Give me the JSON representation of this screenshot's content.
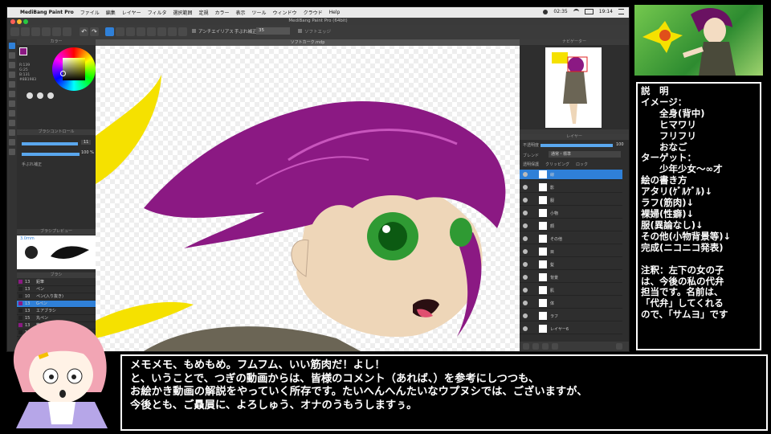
{
  "app": {
    "menubar": {
      "apple": "",
      "items": [
        "MediBang Paint Pro",
        "ファイル",
        "編集",
        "レイヤー",
        "フィルタ",
        "選択範囲",
        "定規",
        "カラー",
        "表示",
        "ツール",
        "ウィンドウ",
        "クラウド",
        "Help"
      ],
      "time1": "02:35",
      "time2": "19:14"
    },
    "window_title": "MediBang Paint Pro (64bit)",
    "toolbar": {
      "antialias": "アンチエイリアス",
      "correction_label": "手ぶれ補正",
      "correction_value": "35",
      "edit_label": "ソフトエッジ"
    },
    "document_tab": "ソフトカーク.mdp",
    "left_panels": {
      "color": "カラー",
      "color_values": [
        "R:139",
        "G:25",
        "B:131",
        "#8B1983"
      ],
      "brush_control": "ブラシコントロール",
      "brush_size_value": "11",
      "opacity_value": "100 %",
      "brush_option": "手ぶれ補正",
      "brush_preview": "ブラシプレビュー",
      "brush_preview_size": "3.0mm",
      "brush": "ブラシ",
      "brush_list": [
        {
          "num": "13",
          "name": "鉛筆"
        },
        {
          "num": "13",
          "name": "ペン"
        },
        {
          "num": "10",
          "name": "ペン(入り抜き)"
        },
        {
          "num": "13",
          "name": "Gペン"
        },
        {
          "num": "13",
          "name": "エアブラシ"
        },
        {
          "num": "15",
          "name": "丸ペン"
        },
        {
          "num": "13",
          "name": "筆"
        },
        {
          "num": "13",
          "name": "水彩"
        },
        {
          "num": "10",
          "name": "ぼかし"
        },
        {
          "num": "13",
          "name": "消しゴム"
        }
      ]
    },
    "right_panels": {
      "navigator": "ナビゲーター",
      "layer": "レイヤー",
      "opacity_label": "不透明度",
      "opacity_value": "100",
      "blend_label": "ブレンド",
      "blend_value": "通常・標準",
      "protect": "透明保護",
      "clipping": "クリッピング",
      "lock": "ロック",
      "layers": [
        "線",
        "影",
        "服",
        "小物",
        "顔",
        "その他",
        "目",
        "髪",
        "背景",
        "肌",
        "体",
        "ラフ",
        "レイヤー6"
      ]
    }
  },
  "description": {
    "lines": [
      "説　明",
      "イメージ：",
      "　　全身(背中)",
      "　　ヒマワリ",
      "　　フリフリ",
      "　　おなご",
      "ターゲット：",
      "　　少年少女～∞才",
      "絵の書き方",
      "アタリ(ｹﾞﾙｹﾞﾙ)↓",
      "ラフ(筋肉)↓",
      "裸婦(性癖)↓",
      "服(異論なし)↓",
      "その他(小物背景等)↓",
      "完成(ニコニコ発表)"
    ],
    "note": [
      "注釈：左下の女の子",
      "は、今後の私の代弁",
      "担当です。名前は、",
      "「代弁」してくれる",
      "ので、「サムヨ」です"
    ]
  },
  "subtitle": [
    "メモメモ、もめもめ。フムフム、いい筋肉だ！よし！",
    "と、いうことで、つぎの動画からは、皆様のコメント（あれば、）を参考にしつつも、",
    "お絵かき動画の解説をやっていく所存です。たいへんへんたいなウプヌシでは、ございますが、",
    "今後とも、ご贔屓に、よろしゅう、オナのうもうしますぅ。"
  ],
  "colors": {
    "hair": "#8b1983",
    "eyes": "#3aa03a",
    "accent": "#2f80d8"
  }
}
